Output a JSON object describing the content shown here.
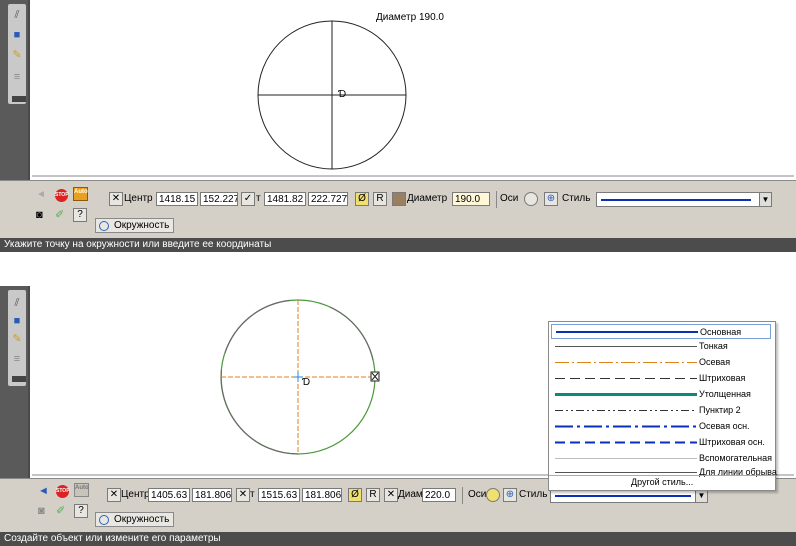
{
  "top": {
    "annotation": "Диаметр 190.0",
    "center_label": "Центр",
    "center_x": "1418.15",
    "center_y": "152.227",
    "t_label": "т",
    "point_x": "1481.82",
    "point_y": "222.727",
    "r_label": "R",
    "diameter_label": "Диаметр",
    "diameter_value": "190.0",
    "axes_label": "Оси",
    "style_label": "Стиль",
    "tab_label": "Окружность",
    "status": "Укажите точку на окружности или введите ее координаты",
    "stop_label": "STOP",
    "auto_label": "Auto",
    "question_label": "?"
  },
  "bottom": {
    "center_label": "Центр",
    "center_x": "1405.63",
    "center_y": "181.806",
    "t_label": "т",
    "point_x": "1515.63",
    "point_y": "181.806",
    "r_label": "R",
    "diameter_label": "Диаметр",
    "diameter_value": "220.0",
    "axes_label": "Оси",
    "style_label": "Стиль",
    "tab_label": "Окружность",
    "status": "Создайте объект или измените его параметры",
    "stop_label": "STOP",
    "auto_label": "Auto",
    "question_label": "?"
  },
  "style_menu": {
    "items": [
      {
        "label": "Основная",
        "color": "#0a2fb8",
        "pattern": "solid-thick"
      },
      {
        "label": "Тонкая",
        "color": "#555555",
        "pattern": "solid-thin"
      },
      {
        "label": "Осевая",
        "color": "#e0821a",
        "pattern": "dash-dot"
      },
      {
        "label": "Штриховая",
        "color": "#333333",
        "pattern": "dashed"
      },
      {
        "label": "Утолщенная",
        "color": "#0a8a7a",
        "pattern": "solid-heavy"
      },
      {
        "label": "Пунктир 2",
        "color": "#333333",
        "pattern": "dash-dot-dot"
      },
      {
        "label": "Осевая осн.",
        "color": "#0a2fb8",
        "pattern": "dash-dot-thick"
      },
      {
        "label": "Штриховая осн.",
        "color": "#0a2fb8",
        "pattern": "dashed-thick"
      },
      {
        "label": "Вспомогательная",
        "color": "#999999",
        "pattern": "solid-hair"
      },
      {
        "label": "Для линии обрыва",
        "color": "#555555",
        "pattern": "solid-thin"
      }
    ],
    "other_label": "Другой стиль..."
  },
  "colors": {
    "main_line": "#0a2fb8",
    "axis_orange": "#e0821a",
    "circle_green": "#4a9a3a",
    "toolbar_bg": "#d4d0c8",
    "status_bg": "#4c4c4c"
  }
}
